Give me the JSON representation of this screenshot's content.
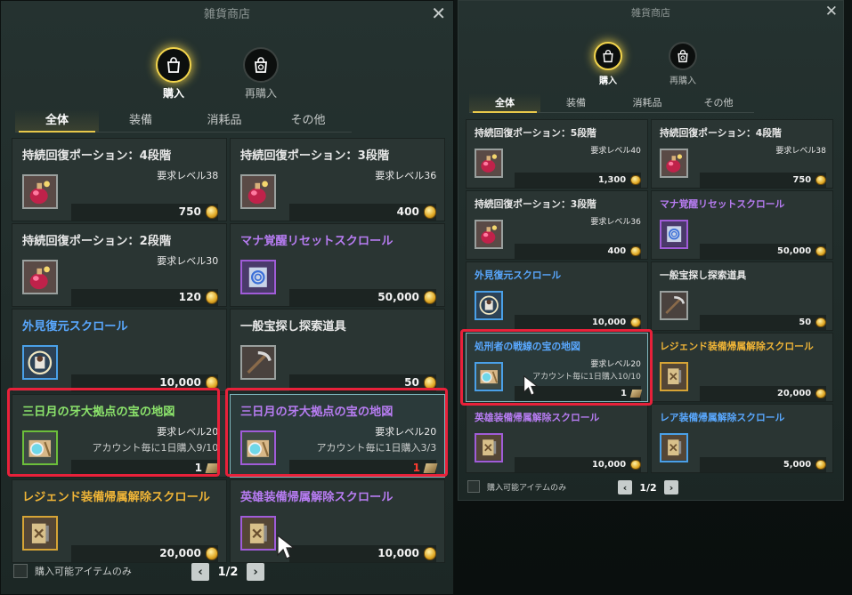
{
  "left": {
    "title": "雑貨商店",
    "modes": [
      {
        "label": "購入",
        "icon": "shopping-bag-icon",
        "active": true
      },
      {
        "label": "再購入",
        "icon": "buyback-bag-icon",
        "active": false
      }
    ],
    "tabs": [
      {
        "label": "全体",
        "active": true
      },
      {
        "label": "装備",
        "active": false
      },
      {
        "label": "消耗品",
        "active": false
      },
      {
        "label": "その他",
        "active": false
      }
    ],
    "items": [
      {
        "name": "持続回復ポーション：4段階",
        "color": "white",
        "req": "要求レベル38",
        "account": "",
        "price": "750",
        "currency": "coin",
        "icon": "potion-icon",
        "frame": "white"
      },
      {
        "name": "持続回復ポーション：3段階",
        "color": "white",
        "req": "要求レベル36",
        "account": "",
        "price": "400",
        "currency": "coin",
        "icon": "potion-icon",
        "frame": "white"
      },
      {
        "name": "持続回復ポーション：2段階",
        "color": "white",
        "req": "要求レベル30",
        "account": "",
        "price": "120",
        "currency": "coin",
        "icon": "potion-icon",
        "frame": "white"
      },
      {
        "name": "マナ覚醒リセットスクロール",
        "color": "purple",
        "req": "",
        "account": "",
        "price": "50,000",
        "currency": "coin",
        "icon": "mana-scroll-icon",
        "frame": "purple"
      },
      {
        "name": "外見復元スクロール",
        "color": "blue",
        "req": "",
        "account": "",
        "price": "10,000",
        "currency": "coin",
        "icon": "appearance-scroll-icon",
        "frame": "blue"
      },
      {
        "name": "一般宝探し探索道具",
        "color": "white",
        "req": "",
        "account": "",
        "price": "50",
        "currency": "coin",
        "icon": "pickaxe-icon",
        "frame": "white"
      },
      {
        "name": "三日月の牙大拠点の宝の地図",
        "color": "green",
        "req": "要求レベル20",
        "account": "アカウント毎に1日購入9/10",
        "price": "1",
        "currency": "ticket",
        "icon": "treasure-map-icon",
        "frame": "green",
        "price_red": false
      },
      {
        "name": "三日月の牙大拠点の宝の地図",
        "color": "purple",
        "req": "要求レベル20",
        "account": "アカウント毎に1日購入3/3",
        "price": "1",
        "currency": "ticket",
        "icon": "treasure-map-icon",
        "frame": "purple",
        "price_red": true,
        "selected": true
      },
      {
        "name": "レジェンド装備帰属解除スクロール",
        "color": "gold",
        "req": "",
        "account": "",
        "price": "20,000",
        "currency": "coin",
        "icon": "unbind-scroll-icon",
        "frame": "gold"
      },
      {
        "name": "英雄装備帰属解除スクロール",
        "color": "purple",
        "req": "",
        "account": "",
        "price": "10,000",
        "currency": "coin",
        "icon": "unbind-scroll-icon",
        "frame": "purple"
      }
    ],
    "filter_label": "購入可能アイテムのみ",
    "page": "1/2"
  },
  "right": {
    "title": "雑貨商店",
    "modes": [
      {
        "label": "購入",
        "icon": "shopping-bag-icon",
        "active": true
      },
      {
        "label": "再購入",
        "icon": "buyback-bag-icon",
        "active": false
      }
    ],
    "tabs": [
      {
        "label": "全体",
        "active": true
      },
      {
        "label": "装備",
        "active": false
      },
      {
        "label": "消耗品",
        "active": false
      },
      {
        "label": "その他",
        "active": false
      }
    ],
    "items": [
      {
        "name": "持続回復ポーション：5段階",
        "color": "white",
        "req": "要求レベル40",
        "account": "",
        "price": "1,300",
        "currency": "coin",
        "icon": "potion-icon",
        "frame": "white"
      },
      {
        "name": "持続回復ポーション：4段階",
        "color": "white",
        "req": "要求レベル38",
        "account": "",
        "price": "750",
        "currency": "coin",
        "icon": "potion-icon",
        "frame": "white"
      },
      {
        "name": "持続回復ポーション：3段階",
        "color": "white",
        "req": "要求レベル36",
        "account": "",
        "price": "400",
        "currency": "coin",
        "icon": "potion-icon",
        "frame": "white"
      },
      {
        "name": "マナ覚醒リセットスクロール",
        "color": "purple",
        "req": "",
        "account": "",
        "price": "50,000",
        "currency": "coin",
        "icon": "mana-scroll-icon",
        "frame": "purple"
      },
      {
        "name": "外見復元スクロール",
        "color": "blue",
        "req": "",
        "account": "",
        "price": "10,000",
        "currency": "coin",
        "icon": "appearance-scroll-icon",
        "frame": "blue"
      },
      {
        "name": "一般宝探し探索道具",
        "color": "white",
        "req": "",
        "account": "",
        "price": "50",
        "currency": "coin",
        "icon": "pickaxe-icon",
        "frame": "white"
      },
      {
        "name": "処刑者の戦線の宝の地図",
        "color": "blue",
        "req": "要求レベル20",
        "account": "アカウント毎に1日購入10/10",
        "price": "1",
        "currency": "ticket",
        "icon": "treasure-map-icon",
        "frame": "blue",
        "selected": true
      },
      {
        "name": "レジェンド装備帰属解除スクロール",
        "color": "gold",
        "req": "",
        "account": "",
        "price": "20,000",
        "currency": "coin",
        "icon": "unbind-scroll-icon",
        "frame": "gold"
      },
      {
        "name": "英雄装備帰属解除スクロール",
        "color": "purple",
        "req": "",
        "account": "",
        "price": "10,000",
        "currency": "coin",
        "icon": "unbind-scroll-icon",
        "frame": "purple"
      },
      {
        "name": "レア装備帰属解除スクロール",
        "color": "blue",
        "req": "",
        "account": "",
        "price": "5,000",
        "currency": "coin",
        "icon": "unbind-scroll-icon",
        "frame": "blue"
      }
    ],
    "filter_label": "購入可能アイテムのみ",
    "page": "1/2"
  }
}
